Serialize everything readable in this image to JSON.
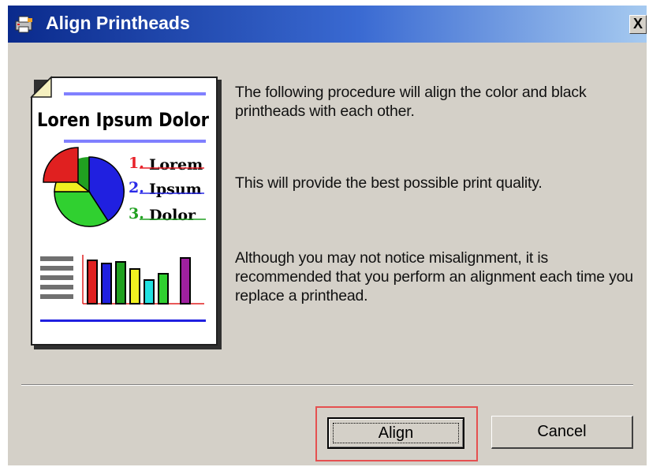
{
  "window": {
    "title": "Align Printheads",
    "close_label": "X",
    "icon": "printer-app-icon"
  },
  "illustration": {
    "icon": "document-illustration",
    "heading": "Loren Ipsum Dolor",
    "list": [
      {
        "number": "1.",
        "text": "Lorem",
        "color": "#e8222a"
      },
      {
        "number": "2.",
        "text": "Ipsum",
        "color": "#2a2ae8"
      },
      {
        "number": "3.",
        "text": "Dolor",
        "color": "#20a020"
      }
    ]
  },
  "messages": {
    "line1": "The following procedure will align the color and black printheads with each other.",
    "line2": "This will provide the best possible print quality.",
    "line3": "Although you may not notice misalignment, it is recommended that you perform an alignment each time you replace a printhead."
  },
  "buttons": {
    "align": "Align",
    "cancel": "Cancel"
  },
  "colors": {
    "titlebar_start": "#0a2a8c",
    "titlebar_end": "#a6caf0",
    "dialog_bg": "#d4d0c8",
    "highlight": "#e55050"
  }
}
